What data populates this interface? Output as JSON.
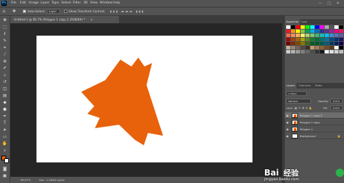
{
  "app": {
    "logo": "Ps",
    "window_controls": [
      "—",
      "□",
      "✕"
    ]
  },
  "menubar": {
    "items": [
      "File",
      "Edit",
      "Image",
      "Layer",
      "Type",
      "Select",
      "Filter",
      "3D",
      "View",
      "Window",
      "Help"
    ]
  },
  "options": {
    "auto_select_label": "Auto-Select:",
    "auto_select_value": "Layer",
    "transform_label": "Show Transform Controls"
  },
  "document": {
    "tab_title": "Untitled-1 @ 66.7% (Polygon 1 copy 2, RGB/8#) *",
    "tab_close": "×"
  },
  "status": {
    "zoom": "66.67%",
    "doc_info": "Doc: 1.04M/0 bytes"
  },
  "panels": {
    "swatches_tabs": [
      "Swatches",
      "Color"
    ],
    "layers_tabs": [
      "Layers",
      "Channels",
      "Paths"
    ],
    "kind_label": "Kind",
    "blend_mode": "Normal",
    "opacity_label": "Opacity:",
    "opacity_value": "100%",
    "lock_label": "Lock:",
    "fill_label": "Fill:",
    "fill_value": "100%",
    "layers": [
      {
        "name": "Polygon 1 copy 2",
        "selected": true
      },
      {
        "name": "Polygon 1 copy",
        "selected": false
      },
      {
        "name": "Polygon 1",
        "selected": false
      },
      {
        "name": "Background",
        "selected": false
      }
    ]
  },
  "colors": {
    "foreground": "#e8620c",
    "background": "#ffffff",
    "shape": "#e8620c"
  },
  "tools": [
    "move-icon",
    "marquee-icon",
    "lasso-icon",
    "quick-select-icon",
    "crop-icon",
    "eyedropper-icon",
    "healing-icon",
    "brush-icon",
    "stamp-icon",
    "history-brush-icon",
    "eraser-icon",
    "gradient-icon",
    "blur-icon",
    "dodge-icon",
    "pen-icon",
    "type-icon",
    "path-select-icon",
    "shape-icon",
    "hand-icon",
    "zoom-icon"
  ],
  "watermark": {
    "text": "经验",
    "site": "jingyan.baidu.com"
  }
}
